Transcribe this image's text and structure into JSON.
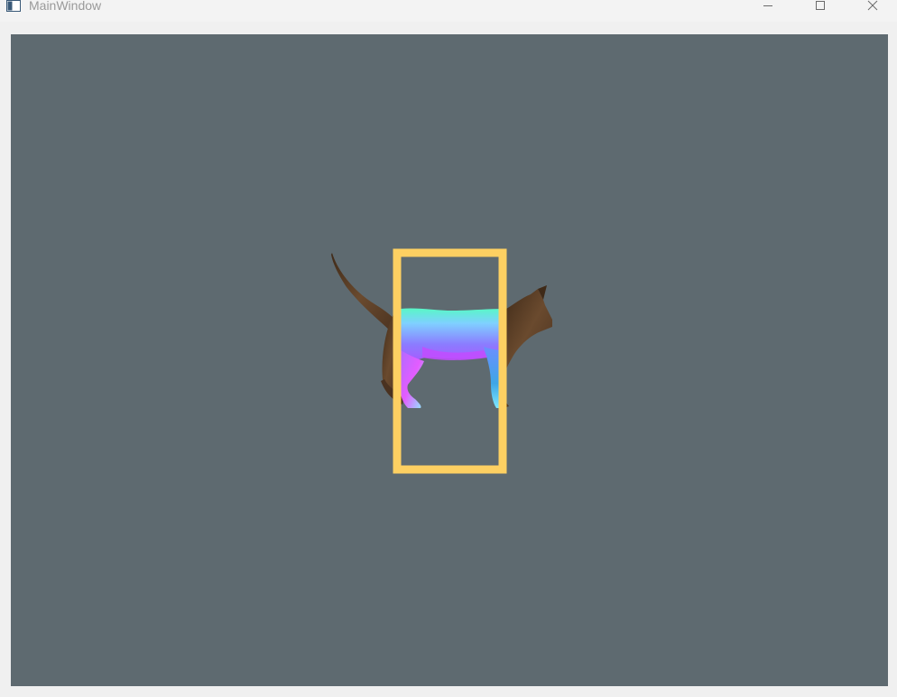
{
  "window": {
    "title": "MainWindow",
    "icon": "app-window-icon",
    "controls": {
      "minimize": "minimize-icon",
      "maximize": "maximize-icon",
      "close": "close-icon"
    }
  },
  "viewport": {
    "background": "#5e6a70",
    "scene": {
      "subject": "cat",
      "frame_color": "#fdd062",
      "fur_color": "#5c3f26",
      "normal_map_colors": [
        "#8fe3ff",
        "#9b7cff",
        "#c04cff",
        "#6fb8ff",
        "#52ffc0"
      ]
    }
  }
}
